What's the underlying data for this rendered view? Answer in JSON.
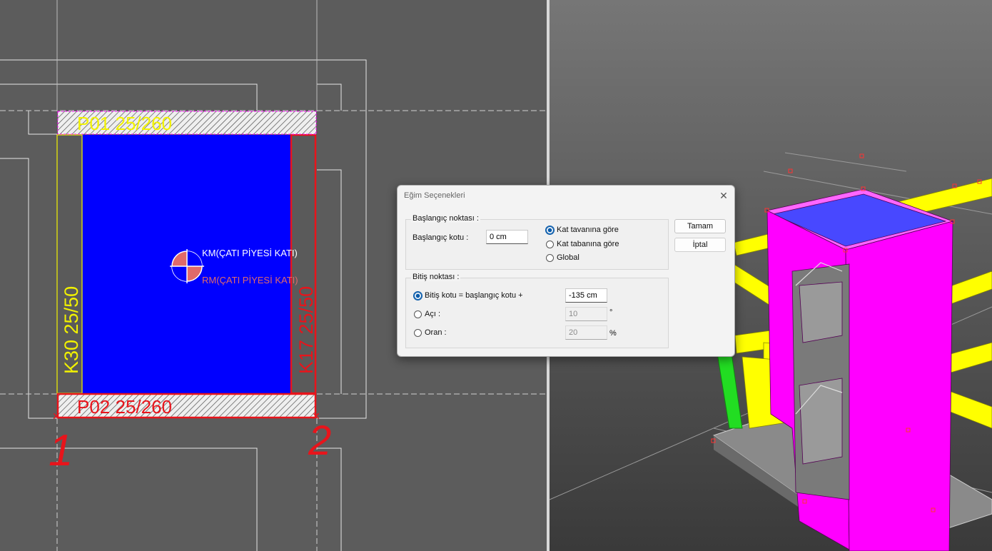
{
  "plan": {
    "beam_top": "P01 25/260",
    "beam_bottom": "P02 25/260",
    "column_left": "K30 25/50",
    "column_right": "K17 25/50",
    "mass_center": "KM(ÇATI PİYESİ KATI)",
    "rigidity_center": "RM(ÇATI PİYESİ KATI)",
    "axis_1": "1",
    "axis_2": "2"
  },
  "dialog": {
    "title": "Eğim Seçenekleri",
    "start_group": {
      "title": "Başlangıç noktası :",
      "level_label": "Başlangıç kotu :",
      "level_value": "0 cm",
      "options": [
        {
          "label": "Kat tavanına göre",
          "selected": true
        },
        {
          "label": "Kat tabanına göre",
          "selected": false
        },
        {
          "label": "Global",
          "selected": false
        }
      ]
    },
    "end_group": {
      "title": "Bitiş noktası :",
      "rows": [
        {
          "label": "Bitiş kotu = başlangıç kotu +",
          "value": "-135 cm",
          "unit": "",
          "selected": true,
          "enabled": true
        },
        {
          "label": "Açı :",
          "value": "10",
          "unit": "°",
          "selected": false,
          "enabled": false
        },
        {
          "label": "Oran :",
          "value": "20",
          "unit": "%",
          "selected": false,
          "enabled": false
        }
      ]
    },
    "ok_label": "Tamam",
    "cancel_label": "İptal"
  },
  "colors": {
    "slab": "#0000ff",
    "beam_red": "#e8141b",
    "label_yellow": "#f2f200",
    "wall_magenta": "#ff00ff",
    "beam_yellow": "#ffff00",
    "dialog_accent": "#0b5cab"
  }
}
